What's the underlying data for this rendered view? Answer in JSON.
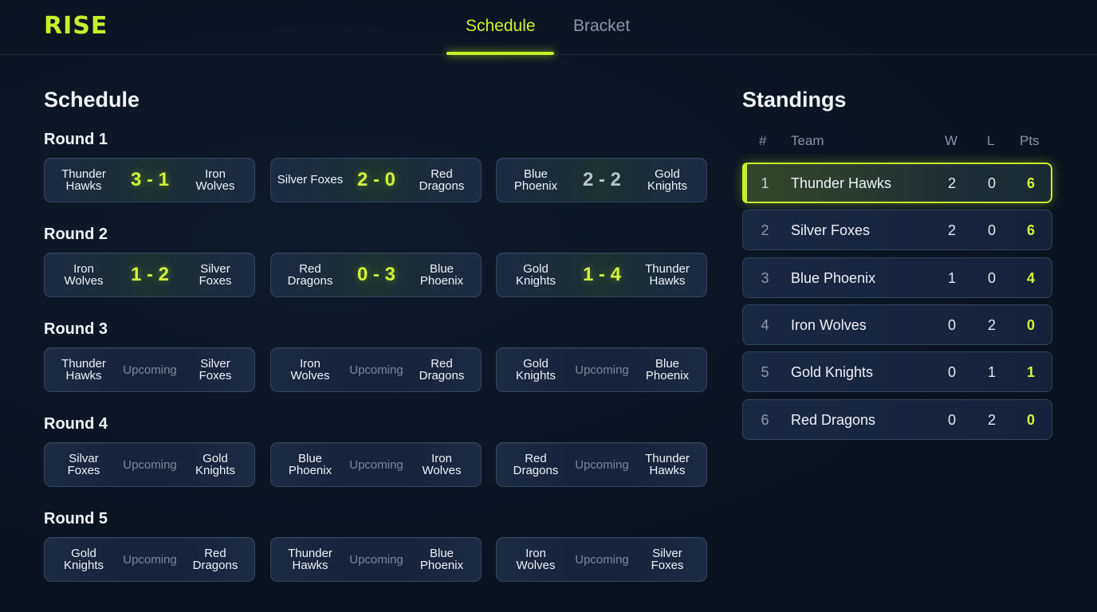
{
  "brand": {
    "logo": "RISE",
    "accent": "#c6f02b"
  },
  "nav": {
    "tabs": [
      {
        "label": "Schedule",
        "active": true
      },
      {
        "label": "Bracket",
        "active": false
      }
    ]
  },
  "schedule": {
    "title": "Schedule",
    "rounds": [
      {
        "label": "Round 1",
        "matches": [
          {
            "home": "Thunder Hawks",
            "away": "Iron Wolves",
            "result": "3 - 1"
          },
          {
            "home": "Silver Foxes",
            "away": "Red Dragons",
            "result": "2 - 0"
          },
          {
            "home": "Blue Phoenix",
            "away": "Gold Knights",
            "result": "2 - 2"
          }
        ]
      },
      {
        "label": "Round 2",
        "matches": [
          {
            "home": "Iron Wolves",
            "away": "Silver Foxes",
            "result": "1 - 2"
          },
          {
            "home": "Red Dragons",
            "away": "Blue Phoenix",
            "result": "0 - 3"
          },
          {
            "home": "Gold Knights",
            "away": "Thunder Hawks",
            "result": "1 - 4"
          }
        ]
      },
      {
        "label": "Round 3",
        "matches": [
          {
            "home": "Thunder Hawks",
            "away": "Silver Foxes",
            "result": "Upcoming"
          },
          {
            "home": "Iron Wolves",
            "away": "Red Dragons",
            "result": "Upcoming"
          },
          {
            "home": "Gold Knights",
            "away": "Blue Phoenix",
            "result": "Upcoming"
          }
        ]
      },
      {
        "label": "Round 4",
        "matches": [
          {
            "home": "Silvar Foxes",
            "away": "Gold Knights",
            "result": "Upcoming"
          },
          {
            "home": "Blue Phoenix",
            "away": "Iron Wolves",
            "result": "Upcoming"
          },
          {
            "home": "Red Dragons",
            "away": "Thunder Hawks",
            "result": "Upcoming"
          }
        ]
      },
      {
        "label": "Round 5",
        "matches": [
          {
            "home": "Gold Knights",
            "away": "Red Dragons",
            "result": "Upcoming"
          },
          {
            "home": "Thunder Hawks",
            "away": "Blue Phoenix",
            "result": "Upcoming"
          },
          {
            "home": "Iron Wolves",
            "away": "Silver Foxes",
            "result": "Upcoming"
          }
        ]
      }
    ]
  },
  "standings": {
    "title": "Standings",
    "columns": [
      "#",
      "Team",
      "W",
      "L",
      "Pts"
    ],
    "rows": [
      {
        "rank": "1",
        "team": "Thunder Hawks",
        "w": "2",
        "l": "0",
        "pts": "6"
      },
      {
        "rank": "2",
        "team": "Silver Foxes",
        "w": "2",
        "l": "0",
        "pts": "6"
      },
      {
        "rank": "3",
        "team": "Blue Phoenix",
        "w": "1",
        "l": "0",
        "pts": "4"
      },
      {
        "rank": "4",
        "team": "Iron Wolves",
        "w": "0",
        "l": "2",
        "pts": "0"
      },
      {
        "rank": "5",
        "team": "Gold Knights",
        "w": "0",
        "l": "1",
        "pts": "1"
      },
      {
        "rank": "6",
        "team": "Red Dragons",
        "w": "0",
        "l": "2",
        "pts": "0"
      }
    ]
  }
}
